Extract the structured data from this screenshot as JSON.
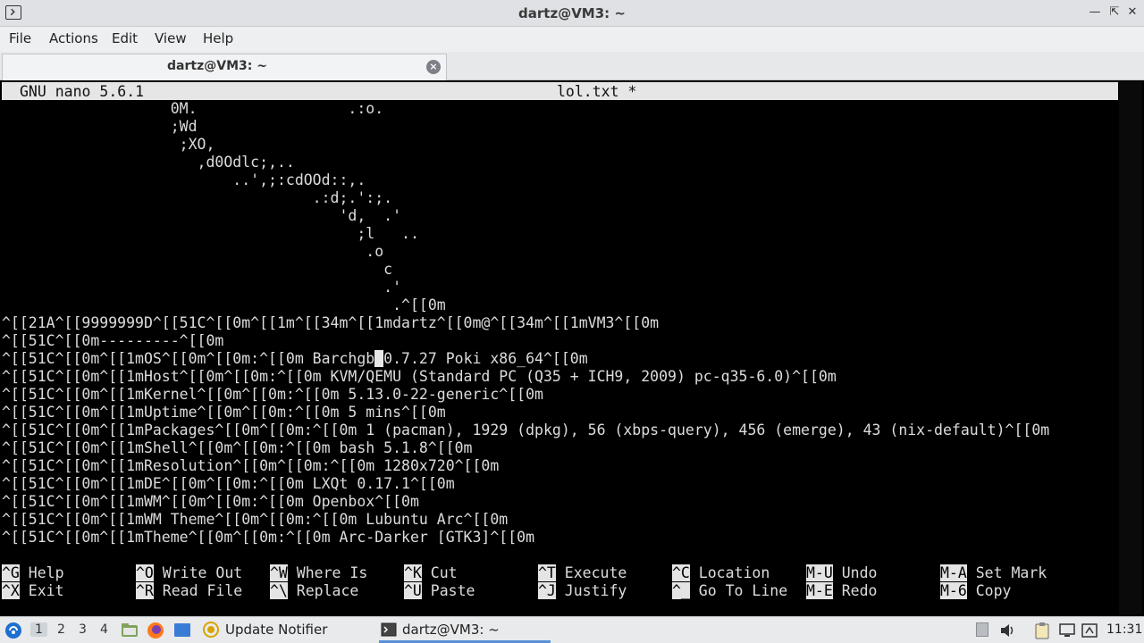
{
  "window": {
    "title": "dartz@VM3: ~"
  },
  "menu": [
    "File",
    "Actions",
    "Edit",
    "View",
    "Help"
  ],
  "tab": {
    "label": "dartz@VM3: ~"
  },
  "nano": {
    "version": "GNU nano 5.6.1",
    "filename": "lol.txt *"
  },
  "editor": {
    "art_lines": [
      "                   0M.                 .:o.",
      "                   ;Wd",
      "                    ;XO,",
      "                      ,d0Odlc;,..",
      "                          ..',;:cdOOd::,.",
      "                                   .:d;.':;.",
      "                                      'd,  .'",
      "                                        ;l   ..",
      "                                         .o",
      "                                           c",
      "                                           .'",
      "                                            .^[[0m"
    ],
    "info_lines": [
      "^[[21A^[[9999999D^[[51C^[[0m^[[1m^[[34m^[[1mdartz^[[0m@^[[34m^[[1mVM3^[[0m",
      "^[[51C^[[0m---------^[[0m",
      "^[[51C^[[0m^[[1mOS^[[0m^[[0m:^[[0m Barchgb",
      "^[[51C^[[0m^[[1mHost^[[0m^[[0m:^[[0m KVM/QEMU (Standard PC (Q35 + ICH9, 2009) pc-q35-6.0)^[[0m",
      "^[[51C^[[0m^[[1mKernel^[[0m^[[0m:^[[0m 5.13.0-22-generic^[[0m",
      "^[[51C^[[0m^[[1mUptime^[[0m^[[0m:^[[0m 5 mins^[[0m",
      "^[[51C^[[0m^[[1mPackages^[[0m^[[0m:^[[0m 1 (pacman), 1929 (dpkg), 56 (xbps-query), 456 (emerge), 43 (nix-default)^[[0m",
      "^[[51C^[[0m^[[1mShell^[[0m^[[0m:^[[0m bash 5.1.8^[[0m",
      "^[[51C^[[0m^[[1mResolution^[[0m^[[0m:^[[0m 1280x720^[[0m",
      "^[[51C^[[0m^[[1mDE^[[0m^[[0m:^[[0m LXQt 0.17.1^[[0m",
      "^[[51C^[[0m^[[1mWM^[[0m^[[0m:^[[0m Openbox^[[0m",
      "^[[51C^[[0m^[[1mWM Theme^[[0m^[[0m:^[[0m Lubuntu Arc^[[0m",
      "^[[51C^[[0m^[[1mTheme^[[0m^[[0m:^[[0m Arc-Darker [GTK3]^[[0m"
    ],
    "cursor_char": " ",
    "os_line_rest": "0.7.27 Poki x86_64^[[0m"
  },
  "shortcuts": [
    {
      "key": "^G",
      "label": " Help"
    },
    {
      "key": "^X",
      "label": " Exit"
    },
    {
      "key": "^O",
      "label": " Write Out"
    },
    {
      "key": "^R",
      "label": " Read File"
    },
    {
      "key": "^W",
      "label": " Where Is"
    },
    {
      "key": "^\\",
      "label": " Replace"
    },
    {
      "key": "^K",
      "label": " Cut"
    },
    {
      "key": "^U",
      "label": " Paste"
    },
    {
      "key": "^T",
      "label": " Execute"
    },
    {
      "key": "^J",
      "label": " Justify"
    },
    {
      "key": "^C",
      "label": " Location"
    },
    {
      "key": "^_",
      "label": " Go To Line"
    },
    {
      "key": "M-U",
      "label": " Undo"
    },
    {
      "key": "M-E",
      "label": " Redo"
    },
    {
      "key": "M-A",
      "label": " Set Mark"
    },
    {
      "key": "M-6",
      "label": " Copy"
    }
  ],
  "taskbar": {
    "desktops": [
      "1",
      "2",
      "3",
      "4"
    ],
    "tasks": [
      "Update Notifier",
      "dartz@VM3: ~"
    ],
    "clock": "11:31"
  }
}
